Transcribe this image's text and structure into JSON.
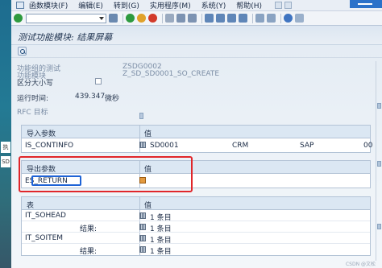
{
  "menubar": {
    "items": [
      "函数模块(F)",
      "编辑(E)",
      "转到(G)",
      "实用程序(M)",
      "系统(Y)",
      "帮助(H)"
    ]
  },
  "left_strip": [
    "执",
    "SD"
  ],
  "window": {
    "title": "测试功能模块: 结果屏幕"
  },
  "header_fields": {
    "test_group_label": "功能组的测试",
    "test_group_value": "ZSDG0002",
    "function_module_label": "功能模块",
    "function_module_value": "Z_SD_SD0001_SO_CREATE",
    "case_sensitive_label": "区分大小写",
    "case_sensitive_checked": false,
    "runtime_label": "运行时间:",
    "runtime_value": "439.347",
    "runtime_unit": "微秒",
    "rfc_label": "RFC 目标"
  },
  "import_table": {
    "header_param": "导入参数",
    "header_value": "值",
    "rows": [
      {
        "param": "IS_CONTINFO",
        "v1": "SD0001",
        "v2": "CRM",
        "v3": "SAP",
        "v4": "00"
      }
    ]
  },
  "export_table": {
    "header_param": "导出参数",
    "header_value": "值",
    "rows": [
      {
        "param": "ES_RETURN"
      }
    ]
  },
  "tables_table": {
    "header_param": "表",
    "header_value": "值",
    "rows": [
      {
        "param": "IT_SOHEAD",
        "value": "1 条目"
      },
      {
        "param": "",
        "label": "结果:",
        "value": "1 条目"
      },
      {
        "param": "IT_SOITEM",
        "value": "1 条目"
      },
      {
        "param": "",
        "label": "结果:",
        "value": "1 条目"
      }
    ]
  },
  "watermark": "CSDN @文松",
  "colors": {
    "highlight_red": "#e0262a",
    "focus_blue": "#1e63d6",
    "title_bar_blue": "#2a71c9"
  }
}
